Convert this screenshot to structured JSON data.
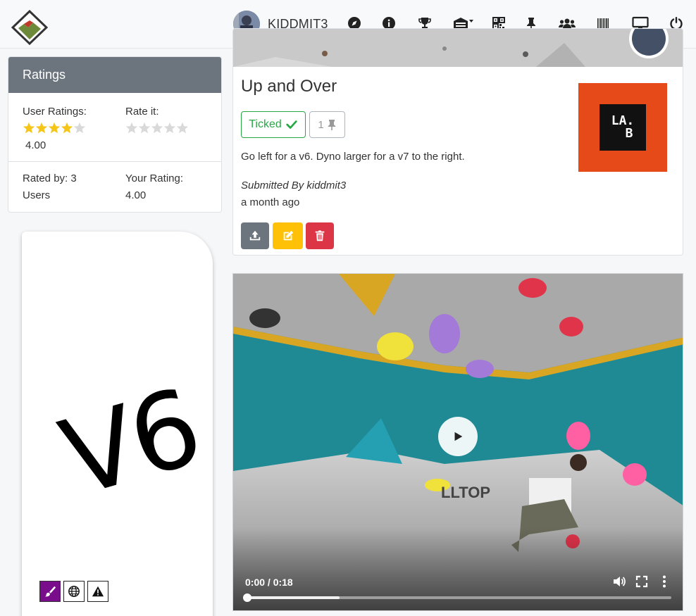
{
  "header": {
    "username": "KIDDMIT3",
    "icons": [
      "compass-icon",
      "info-icon",
      "trophy-icon",
      "gym-dropdown-icon",
      "qr-code-icon",
      "pin-icon",
      "users-icon",
      "barcode-icon",
      "monitor-icon",
      "power-icon"
    ]
  },
  "ratings": {
    "title": "Ratings",
    "user_ratings_label": "User Ratings:",
    "user_rating_value": "4.00",
    "user_rating_stars": 4,
    "rate_it_label": "Rate it:",
    "rated_by_label": "Rated by: 3",
    "rated_by_suffix": "Users",
    "your_rating_label": "Your Rating:",
    "your_rating_value": "4.00",
    "max_stars": 5
  },
  "grade_card": {
    "grade": "V6",
    "badges": [
      "paintbrush-icon",
      "globe-icon",
      "warning-icon"
    ]
  },
  "route": {
    "title": "Up and Over",
    "ticked_label": "Ticked",
    "pin_count": "1",
    "description": "Go left for a v6. Dyno larger for a v7 to the right.",
    "submitted_by": "Submitted By kiddmit3",
    "time_ago": "a month ago",
    "gym_logo_line1": "LA.",
    "gym_logo_line2": "B"
  },
  "video": {
    "time": "0:00 / 0:18",
    "buffered_fraction": 0.22
  },
  "colors": {
    "success": "#28a745",
    "warning": "#ffc107",
    "danger": "#dc3545",
    "secondary": "#6c757d",
    "star": "#f5c518",
    "gym_logo": "#e64a19"
  }
}
